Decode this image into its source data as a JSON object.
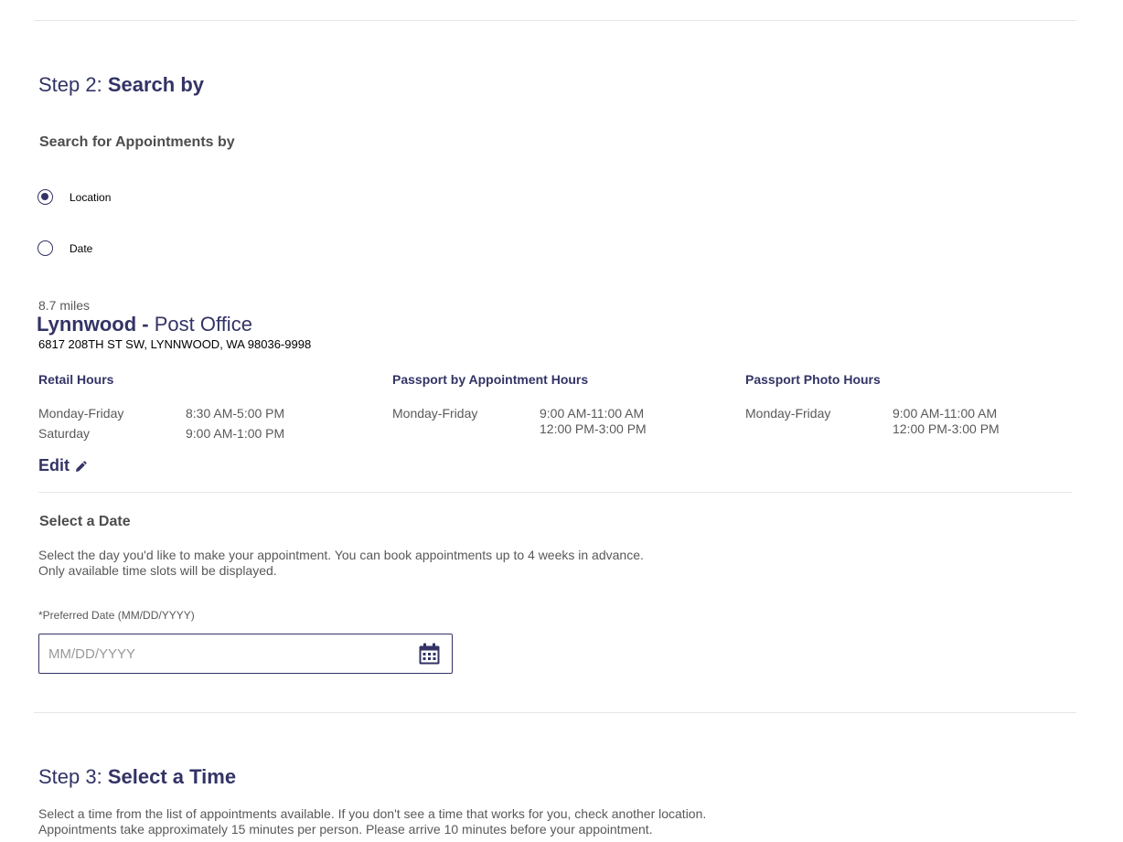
{
  "step2": {
    "prefix": "Step 2:",
    "bold": "Search by"
  },
  "search_for": {
    "heading": "Search for Appointments by",
    "options": [
      {
        "label": "Location",
        "selected": true
      },
      {
        "label": "Date",
        "selected": false
      }
    ]
  },
  "location": {
    "distance": "8.7 miles",
    "name_bold": "Lynnwood",
    "separator": " - ",
    "name_rest": "Post Office",
    "address": "6817 208TH ST SW, LYNNWOOD, WA 98036-9998",
    "hours": {
      "retail": {
        "title": "Retail Hours",
        "rows": [
          {
            "days": "Monday-Friday",
            "times": [
              "8:30 AM-5:00 PM"
            ]
          },
          {
            "days": "Saturday",
            "times": [
              "9:00 AM-1:00 PM"
            ]
          }
        ]
      },
      "passport": {
        "title": "Passport by Appointment Hours",
        "rows": [
          {
            "days": "Monday-Friday",
            "times": [
              "9:00 AM-11:00 AM",
              "12:00 PM-3:00 PM"
            ]
          }
        ]
      },
      "photo": {
        "title": "Passport Photo Hours",
        "rows": [
          {
            "days": "Monday-Friday",
            "times": [
              "9:00 AM-11:00 AM",
              "12:00 PM-3:00 PM"
            ]
          }
        ]
      }
    },
    "edit_label": "Edit"
  },
  "select_date": {
    "heading": "Select a Date",
    "description_line1": "Select the day you'd like to make your appointment. You can book appointments up to 4 weeks in advance.",
    "description_line2": "Only available time slots will be displayed.",
    "field_label": "*Preferred Date (MM/DD/YYYY)",
    "placeholder": "MM/DD/YYYY",
    "value": "",
    "calendar_icon": "calendar-icon"
  },
  "step3": {
    "prefix": "Step 3:",
    "bold": "Select a Time",
    "description_line1": "Select a time from the list of appointments available. If you don't see a time that works for you, check another location.",
    "description_line2": "Appointments take approximately 15 minutes per person. Please arrive 10 minutes before your appointment."
  },
  "colors": {
    "brand_navy": "#333366",
    "text_gray": "#595959",
    "divider": "#e6e6ea"
  }
}
